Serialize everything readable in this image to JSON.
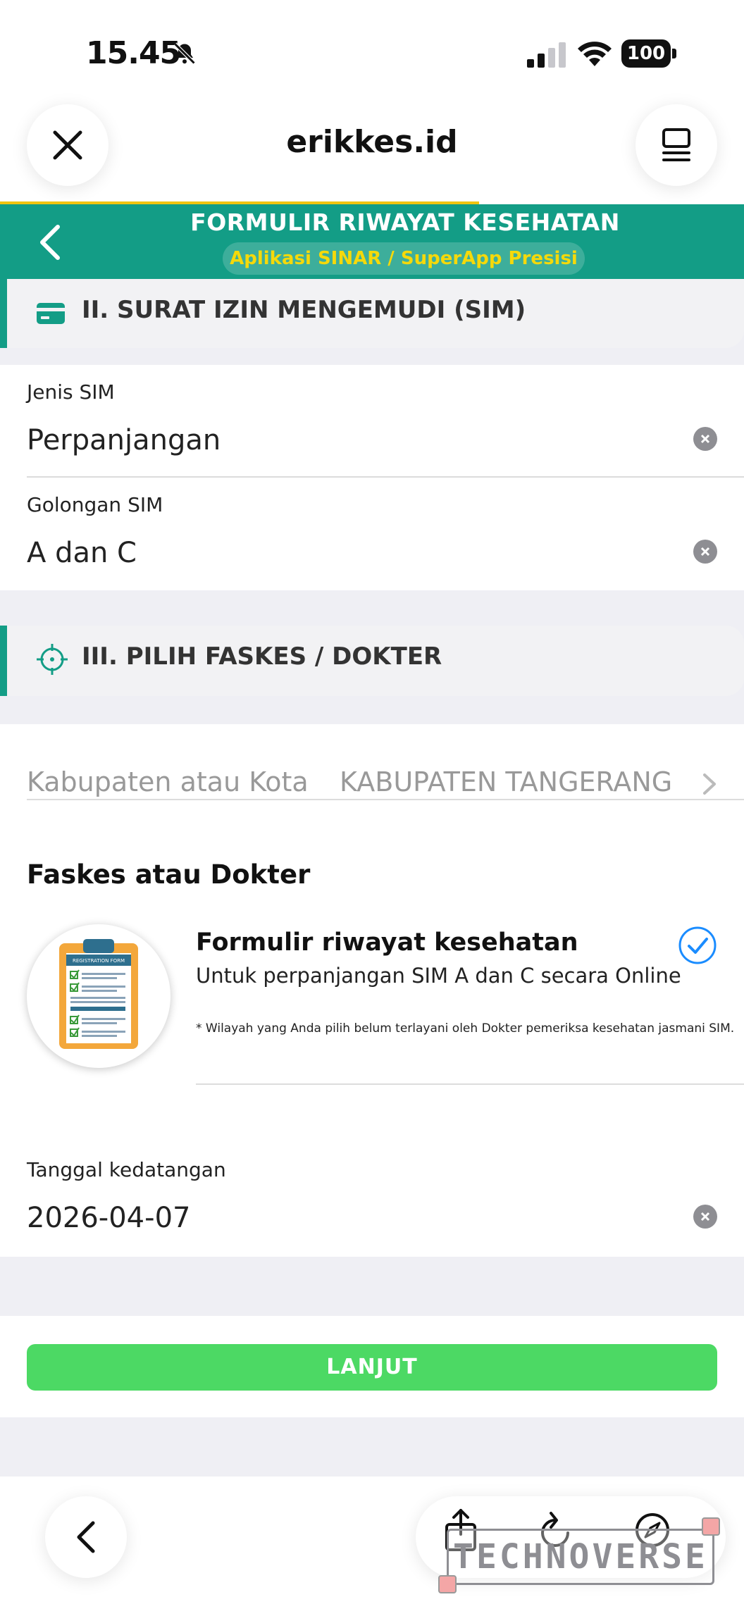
{
  "status_bar": {
    "time": "15.45",
    "battery": "100"
  },
  "browser": {
    "url": "erikkes.id"
  },
  "app_header": {
    "title": "FORMULIR RIWAYAT KESEHATAN",
    "subtitle": "Aplikasi SINAR / SuperApp Presisi"
  },
  "section_sim": {
    "title": "II. SURAT IZIN MENGEMUDI (SIM)",
    "fields": [
      {
        "label": "Jenis SIM",
        "value": "Perpanjangan"
      },
      {
        "label": "Golongan SIM",
        "value": "A dan C"
      }
    ]
  },
  "section_faskes": {
    "title": "III. PILIH FASKES / DOKTER",
    "region_label": "Kabupaten atau Kota",
    "region_value": "KABUPATEN TANGERANG",
    "faskes_heading": "Faskes atau Dokter",
    "item": {
      "title": "Formulir riwayat kesehatan",
      "subtitle": "Untuk perpanjangan SIM A dan C secara Online",
      "note": "* Wilayah yang Anda pilih belum terlayani oleh Dokter pemeriksa kesehatan jasmani SIM.",
      "image_caption": "REGISTRATION FORM",
      "selected": true
    },
    "date_label": "Tanggal kedatangan",
    "date_value": "2026-04-07"
  },
  "actions": {
    "next_label": "LANJUT"
  },
  "watermark": "TECHNOVERSE",
  "colors": {
    "primary": "#139d86",
    "accent_yellow": "#f5d90a",
    "button_green": "#4cd964",
    "check_blue": "#1a8cff"
  },
  "icons": [
    "bell-slash-icon",
    "signal-icon",
    "wifi-icon",
    "close-icon",
    "tabs-icon",
    "back-chevron-icon",
    "id-card-icon",
    "crosshair-icon",
    "clear-icon",
    "chevron-right-icon",
    "check-circle-icon",
    "share-icon",
    "reload-icon",
    "compass-icon"
  ]
}
